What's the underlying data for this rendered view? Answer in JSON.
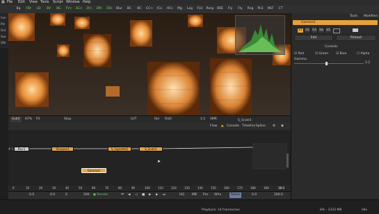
{
  "menubar": {
    "items": [
      "File",
      "Edit",
      "View",
      "Tools",
      "Script",
      "Window",
      "Help"
    ]
  },
  "toolbar": {
    "tools": [
      "Bg",
      "FBt",
      "LD",
      "BV",
      "BG",
      "TV+",
      "3G+",
      "3Fn",
      "3Rh",
      "3Sh",
      "Blur",
      "BC",
      "BC",
      "CC+",
      "ICx",
      "HCs",
      "Mg",
      "Log",
      "FLU",
      "Resp",
      "BSE",
      "Fly",
      "Fly",
      "Rng",
      "PLS",
      "MLT",
      "CT"
    ],
    "colors": {
      "active_tool": "#7fd35d",
      "normal_tool": "#cccccc"
    }
  },
  "left_strip": {
    "items": [
      "Con",
      "Pst",
      "Out",
      "Suo",
      "SPe"
    ]
  },
  "viewer": {
    "scope_icon": "histogram-icon"
  },
  "viewer_toolbar": {
    "items": [
      "SubV",
      "87%",
      "Fit",
      "Stup",
      "LUT",
      "RoI",
      "DoD",
      "1:1",
      "SMR"
    ]
  },
  "right_panel": {
    "tabs": [
      "Tools",
      "Modifiers"
    ],
    "tool_name": "Gamma1",
    "channels": [
      "S1",
      "S2",
      "S3",
      "S4",
      "S5"
    ],
    "buttons": {
      "edit": "Edit",
      "pickup": "Pickout"
    },
    "section": "Controls",
    "checks": [
      {
        "label": "Red",
        "checked": true
      },
      {
        "label": "Green",
        "checked": true
      },
      {
        "label": "Blue",
        "checked": true
      },
      {
        "label": "Alpha",
        "checked": false
      }
    ],
    "gamma_label": "Gamma",
    "gamma_value": "2.2",
    "gamma_fraction": 0.45
  },
  "flow": {
    "header_tabs": [
      "Flow",
      "Console",
      "Timeline",
      "Spline"
    ],
    "title": "S_Snatr1",
    "nodes": [
      {
        "label": "Blur1",
        "color": "#cccccc"
      },
      {
        "label": "Sharpen1",
        "color": "#e0a24e"
      },
      {
        "label": "S_VignetteG",
        "color": "#e0a24e"
      },
      {
        "label": "S_Snatr1",
        "color": "#e0a24e"
      },
      {
        "label": "Gamma1",
        "color": "#e8a640",
        "selected": true
      }
    ],
    "left_label": "# 1"
  },
  "timeline": {
    "ticks": [
      "0",
      "10",
      "20",
      "30",
      "40",
      "50",
      "60",
      "70",
      "80",
      "90",
      "100",
      "110",
      "120",
      "130",
      "140",
      "150",
      "160",
      "170",
      "180",
      "190"
    ],
    "start": "0.0",
    "current": "0.0",
    "render_start": "0",
    "render_end": "200",
    "controls": [
      "Render",
      "HQ",
      "MB",
      "Prx",
      "APrx",
      "Some"
    ],
    "frame": "0.0",
    "end": "200.0",
    "playhead_label": "18.0"
  },
  "status": {
    "left": "Playback: 14 frames/sec",
    "mem": "8% - 1333 MB",
    "state": "Idle"
  }
}
